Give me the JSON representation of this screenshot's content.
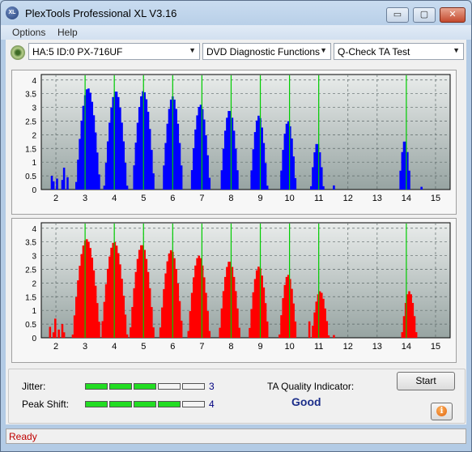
{
  "window": {
    "title": "PlexTools Professional XL V3.16",
    "app_icon_text": "XL",
    "minimize_glyph": "▭",
    "maximize_glyph": "▢",
    "close_glyph": "✕"
  },
  "menu": {
    "items": [
      "Options",
      "Help"
    ]
  },
  "toolbar": {
    "drive": "HA:5 ID:0  PX-716UF",
    "function": "DVD Diagnostic Functions",
    "test": "Q-Check TA Test",
    "arrow": "▼"
  },
  "colors": {
    "top_chart_fill": "#0000ff",
    "bottom_chart_fill": "#ff0000",
    "marker_line": "#00cc00",
    "plot_bg_top": "#e9eceb",
    "plot_bg_bottom": "#97a4a2",
    "meter_on": "#22dd22",
    "meter_off": "#f4f4f4"
  },
  "chart_data": [
    {
      "type": "area",
      "name": "top",
      "xlim": [
        1.5,
        15.5
      ],
      "ylim": [
        0,
        4.2
      ],
      "x_ticks": [
        "2",
        "3",
        "4",
        "5",
        "6",
        "7",
        "8",
        "9",
        "10",
        "11",
        "12",
        "13",
        "14",
        "15"
      ],
      "y_ticks": [
        "0",
        "0.5",
        "1",
        "1.5",
        "2",
        "2.5",
        "3",
        "3.5",
        "4"
      ],
      "markers": [
        3,
        4,
        5,
        6,
        7,
        8,
        9,
        10,
        11,
        14
      ],
      "peaks": [
        {
          "center": 3.1,
          "height": 3.7,
          "width": 0.42
        },
        {
          "center": 4.05,
          "height": 3.6,
          "width": 0.4
        },
        {
          "center": 5.0,
          "height": 3.6,
          "width": 0.38
        },
        {
          "center": 6.0,
          "height": 3.4,
          "width": 0.36
        },
        {
          "center": 6.95,
          "height": 3.1,
          "width": 0.34
        },
        {
          "center": 7.95,
          "height": 2.9,
          "width": 0.32
        },
        {
          "center": 8.95,
          "height": 2.7,
          "width": 0.3
        },
        {
          "center": 9.95,
          "height": 2.5,
          "width": 0.28
        },
        {
          "center": 10.95,
          "height": 1.7,
          "width": 0.22
        },
        {
          "center": 13.95,
          "height": 1.8,
          "width": 0.2
        }
      ],
      "noise": [
        {
          "x": 1.85,
          "h": 0.5
        },
        {
          "x": 1.95,
          "h": 0.3
        },
        {
          "x": 2.05,
          "h": 0.4
        },
        {
          "x": 2.2,
          "h": 0.35
        },
        {
          "x": 2.3,
          "h": 0.8
        },
        {
          "x": 2.4,
          "h": 0.45
        },
        {
          "x": 11.5,
          "h": 0.15
        },
        {
          "x": 14.5,
          "h": 0.1
        }
      ]
    },
    {
      "type": "area",
      "name": "bottom",
      "xlim": [
        1.5,
        15.5
      ],
      "ylim": [
        0,
        4.2
      ],
      "x_ticks": [
        "2",
        "3",
        "4",
        "5",
        "6",
        "7",
        "8",
        "9",
        "10",
        "11",
        "12",
        "13",
        "14",
        "15"
      ],
      "y_ticks": [
        "0",
        "0.5",
        "1",
        "1.5",
        "2",
        "2.5",
        "3",
        "3.5",
        "4"
      ],
      "markers": [
        3,
        4,
        5,
        6,
        7,
        8,
        9,
        10,
        11,
        14
      ],
      "peaks": [
        {
          "center": 3.05,
          "height": 3.6,
          "width": 0.48
        },
        {
          "center": 4.0,
          "height": 3.5,
          "width": 0.45
        },
        {
          "center": 4.95,
          "height": 3.4,
          "width": 0.42
        },
        {
          "center": 5.95,
          "height": 3.2,
          "width": 0.4
        },
        {
          "center": 6.9,
          "height": 3.0,
          "width": 0.38
        },
        {
          "center": 7.95,
          "height": 2.8,
          "width": 0.36
        },
        {
          "center": 8.95,
          "height": 2.6,
          "width": 0.34
        },
        {
          "center": 9.95,
          "height": 2.3,
          "width": 0.3
        },
        {
          "center": 11.05,
          "height": 1.7,
          "width": 0.3
        },
        {
          "center": 14.1,
          "height": 1.7,
          "width": 0.26
        }
      ],
      "noise": [
        {
          "x": 1.8,
          "h": 0.4
        },
        {
          "x": 1.9,
          "h": 0.2
        },
        {
          "x": 2.0,
          "h": 0.7
        },
        {
          "x": 2.1,
          "h": 0.3
        },
        {
          "x": 2.2,
          "h": 0.5
        },
        {
          "x": 2.3,
          "h": 0.2
        },
        {
          "x": 10.7,
          "h": 0.6
        },
        {
          "x": 11.5,
          "h": 0.1
        }
      ]
    }
  ],
  "results": {
    "jitter_label": "Jitter:",
    "jitter_value": "3",
    "jitter_level": 3,
    "peak_shift_label": "Peak Shift:",
    "peak_shift_value": "4",
    "peak_shift_level": 4,
    "meter_segments": 5,
    "ta_label": "TA Quality Indicator:",
    "ta_value": "Good",
    "start_label": "Start",
    "info_glyph": "i"
  },
  "status": {
    "text": "Ready"
  }
}
